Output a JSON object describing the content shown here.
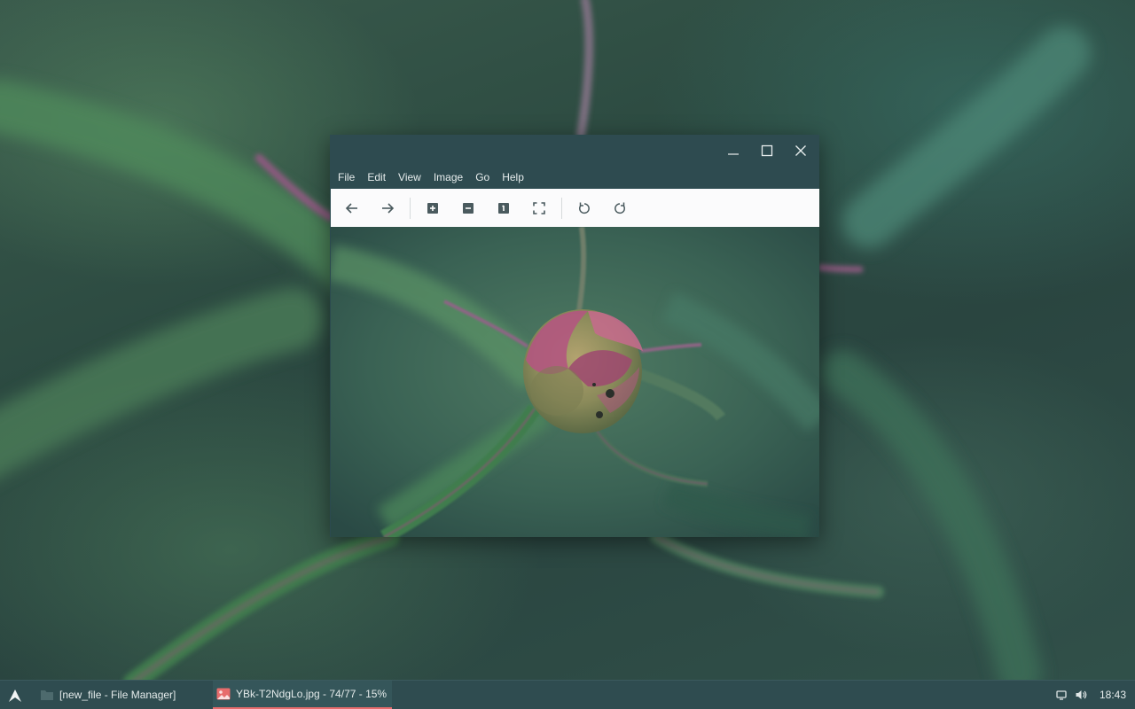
{
  "window": {
    "menu": [
      "File",
      "Edit",
      "View",
      "Image",
      "Go",
      "Help"
    ],
    "controls": {
      "minimize_icon": "minimize-icon",
      "maximize_icon": "maximize-icon",
      "close_icon": "close-icon"
    },
    "toolbar": [
      "back-arrow-icon",
      "forward-arrow-icon",
      "zoom-in-icon",
      "zoom-out-icon",
      "original-size-icon",
      "fit-to-window-icon",
      "rotate-left-icon",
      "rotate-right-icon"
    ],
    "image_subject": "pink-peony-bud-photo"
  },
  "taskbar": {
    "start_icon": "app-launcher-icon",
    "tasks": [
      {
        "label": "[new_file - File Manager]",
        "icon": "folder-icon",
        "active": false
      },
      {
        "label": "YBk-T2NdgLo.jpg - 74/77 - 15%",
        "icon": "image-file-icon",
        "active": true
      }
    ],
    "tray": {
      "display_icon": "display-icon",
      "volume_icon": "volume-icon",
      "clock": "18:43"
    }
  },
  "colors": {
    "window_bg": "#2e4b50",
    "toolbar_bg": "#fbfbfc",
    "taskbar_bg": "#2f4c50",
    "active_task_accent": "#e76c6c",
    "icon_color": "#4a5a5e"
  }
}
